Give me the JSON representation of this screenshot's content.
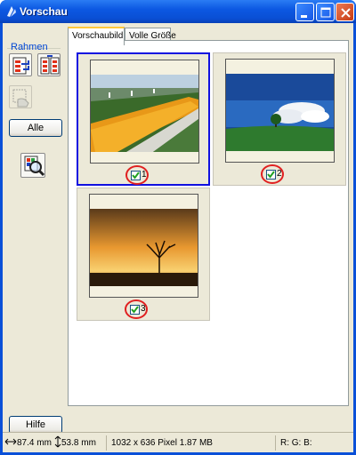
{
  "window": {
    "title": "Vorschau"
  },
  "titlebar_buttons": [
    "minimize-icon",
    "maximize-icon",
    "close-icon"
  ],
  "sidebar": {
    "group_label": "Rahmen",
    "icons": [
      "auto-locate-frame-icon",
      "rotate-frame-icon",
      "delete-frame-icon",
      "zoom-preview-icon"
    ],
    "all_button": "Alle",
    "help_button": "Hilfe"
  },
  "tabs": [
    {
      "label": "Vorschaubild",
      "active": true
    },
    {
      "label": "Volle Größe",
      "active": false
    }
  ],
  "thumbnails": [
    {
      "index": "1",
      "checked": true,
      "selected": true,
      "photo": "flower-field"
    },
    {
      "index": "2",
      "checked": true,
      "selected": false,
      "photo": "tree-sky"
    },
    {
      "index": "3",
      "checked": true,
      "selected": false,
      "photo": "sunset-tree"
    }
  ],
  "status": {
    "width": "87.4 mm",
    "height": "53.8 mm",
    "info": "1032 x 636 Pixel 1.87 MB",
    "rgb": "R: G: B:"
  }
}
